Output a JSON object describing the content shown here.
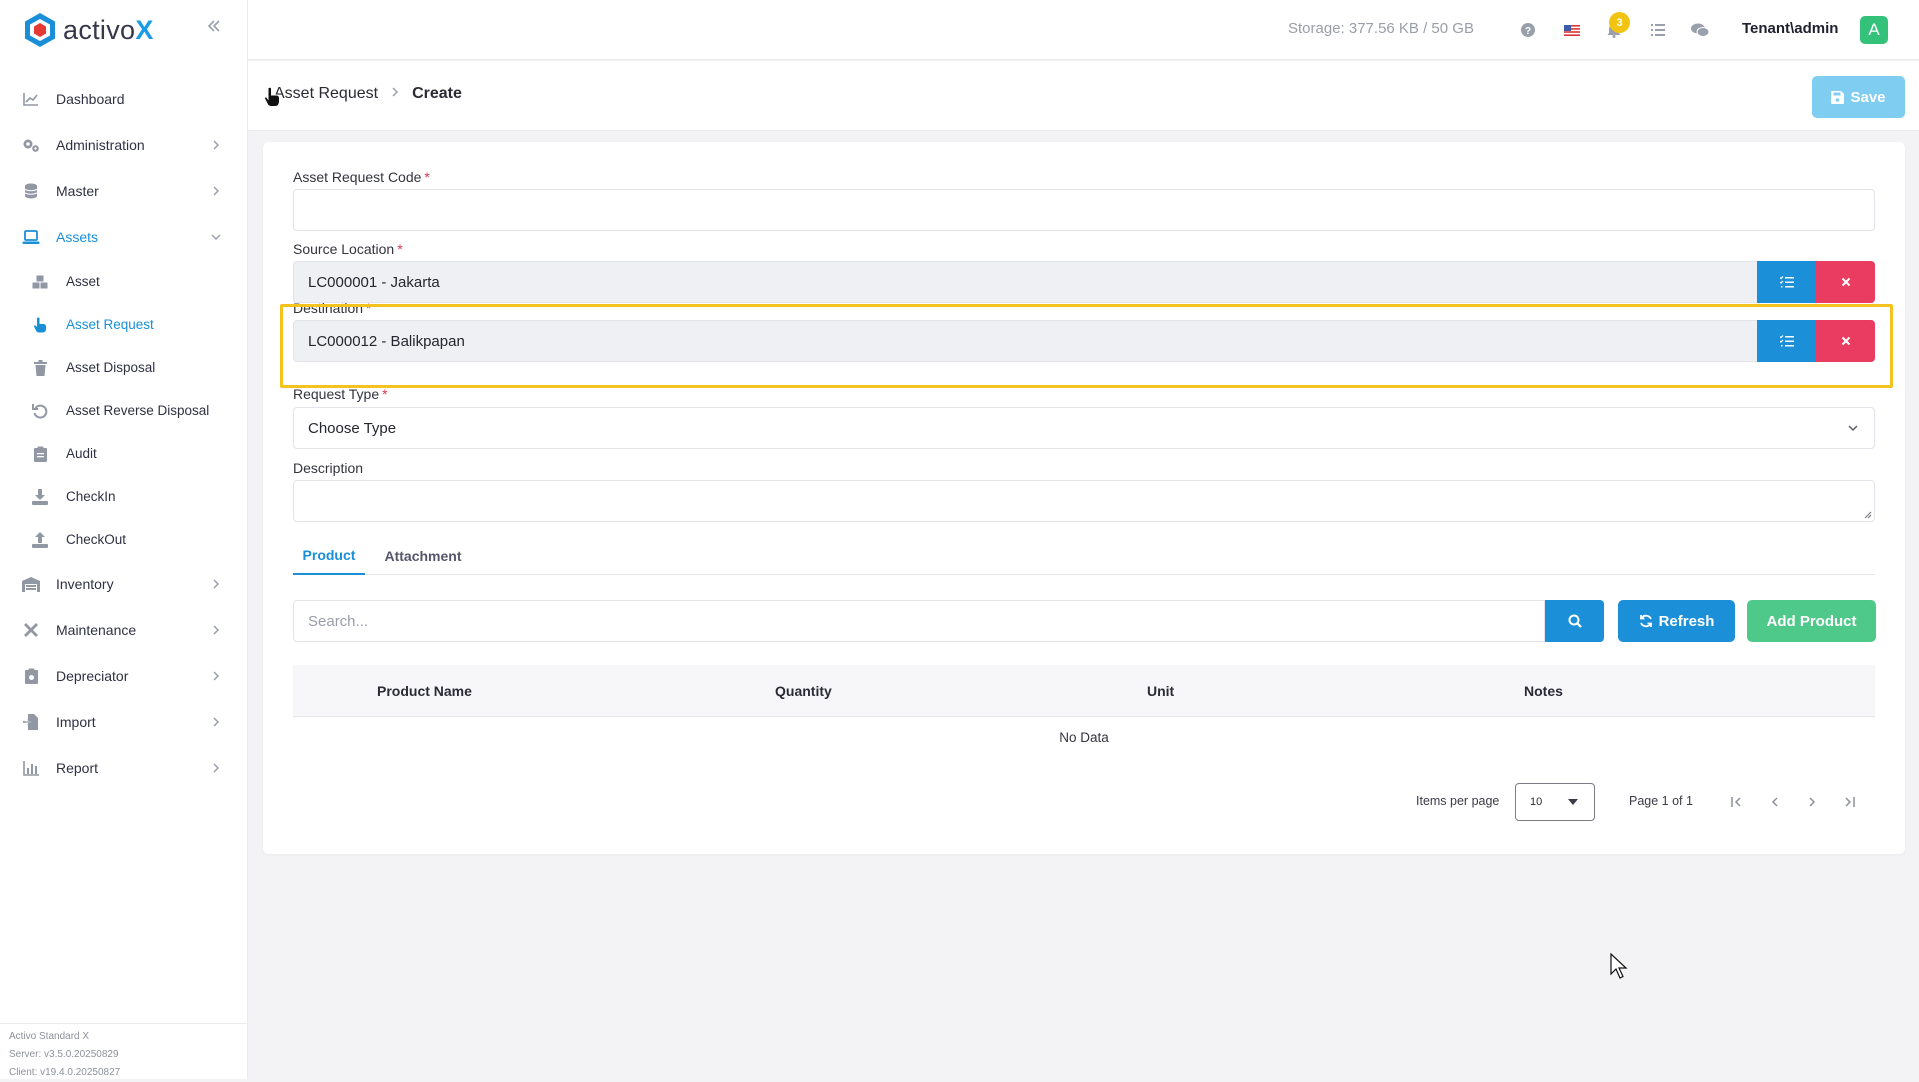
{
  "app": {
    "brand_prefix": "activo",
    "brand_suffix": "X",
    "accent": "#1a8fd8"
  },
  "topbar": {
    "storage": "Storage: 377.56 KB / 50 GB",
    "notif_count": "3",
    "user": "Tenant\\admin",
    "avatar_letter": "A"
  },
  "sidebar": {
    "items": [
      {
        "label": "Dashboard",
        "icon": "chart-line-icon"
      },
      {
        "label": "Administration",
        "icon": "gears-icon"
      },
      {
        "label": "Master",
        "icon": "database-icon"
      },
      {
        "label": "Assets",
        "icon": "laptop-icon"
      },
      {
        "label": "Inventory",
        "icon": "warehouse-icon"
      },
      {
        "label": "Maintenance",
        "icon": "tools-icon"
      },
      {
        "label": "Depreciator",
        "icon": "clipboard-icon"
      },
      {
        "label": "Import",
        "icon": "file-import-icon"
      },
      {
        "label": "Report",
        "icon": "chart-bar-icon"
      }
    ],
    "sub_items": [
      {
        "label": "Asset",
        "icon": "boxes-icon"
      },
      {
        "label": "Asset Request",
        "icon": "hand-pointer-icon"
      },
      {
        "label": "Asset Disposal",
        "icon": "trash-icon"
      },
      {
        "label": "Asset Reverse Disposal",
        "icon": "undo-icon"
      },
      {
        "label": "Audit",
        "icon": "clipboard-check-icon"
      },
      {
        "label": "CheckIn",
        "icon": "download-icon"
      },
      {
        "label": "CheckOut",
        "icon": "upload-icon"
      }
    ],
    "footer": {
      "line1": "Activo Standard X",
      "line2": "Server: v3.5.0.20250829",
      "line3": "Client: v19.4.0.20250827"
    }
  },
  "header": {
    "breadcrumb_parent": "Asset Request",
    "breadcrumb_sep": ">",
    "breadcrumb_current": "Create",
    "save_label": "Save"
  },
  "form": {
    "code_label": "Asset Request Code",
    "code_value": "",
    "source_label": "Source Location",
    "source_value": "LC000001 - Jakarta",
    "destination_label": "Destination",
    "destination_value": "LC000012 - Balikpapan",
    "type_label": "Request Type",
    "type_value": "Choose Type",
    "description_label": "Description",
    "description_value": "",
    "required_mark": "*"
  },
  "tabs": [
    {
      "label": "Product"
    },
    {
      "label": "Attachment"
    }
  ],
  "product": {
    "search_placeholder": "Search...",
    "refresh_label": "Refresh",
    "add_label": "Add Product",
    "columns": [
      "Product Name",
      "Quantity",
      "Unit",
      "Notes"
    ],
    "empty_text": "No Data"
  },
  "pagination": {
    "items_per_page_label": "Items per page",
    "items_per_page_value": "10",
    "page_info": "Page 1 of 1"
  }
}
